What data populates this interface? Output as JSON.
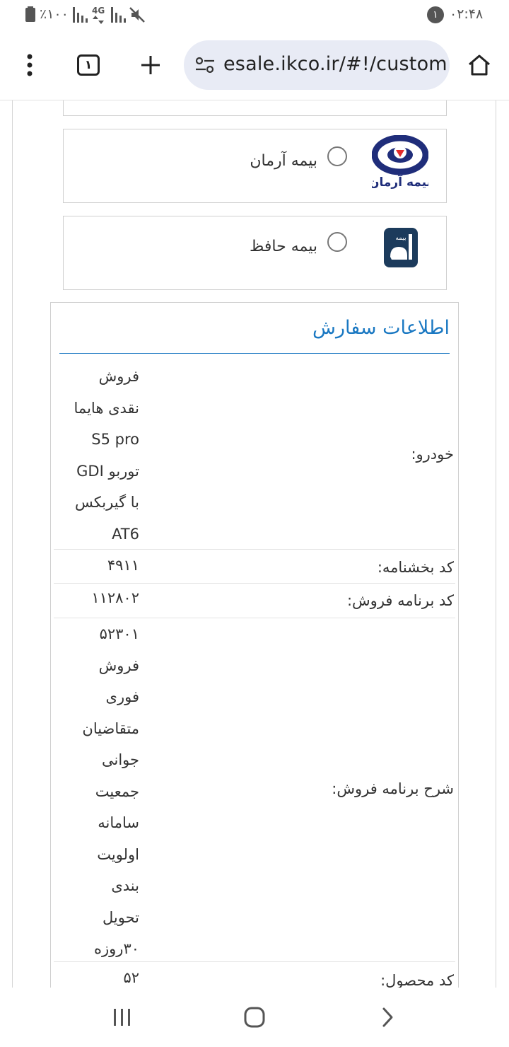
{
  "status_bar": {
    "time": "۰۲:۴۸",
    "notification_count": "۱",
    "battery_percent": "٪۱۰۰",
    "network": "4G"
  },
  "browser": {
    "url": "esale.ikco.ir/#!/custom",
    "tab_count": "۱"
  },
  "insurance_options": [
    {
      "label": "بیمه آرمان",
      "logo_text": "بیمه آرمان",
      "selected": false
    },
    {
      "label": "بیمه حافظ",
      "logo_text": "بیمه",
      "selected": false
    }
  ],
  "order": {
    "title": "اطلاعات سفارش",
    "rows": [
      {
        "label": "خودرو:",
        "value_lines": [
          "فروش",
          "نقدی هایما",
          "S5 pro",
          "توربو GDI",
          "با گیربکس",
          "AT6"
        ]
      },
      {
        "label": "کد بخشنامه:",
        "value_lines": [
          "۴۹۱۱"
        ]
      },
      {
        "label": "کد برنامه فروش:",
        "value_lines": [
          "۱۱۲۸۰۲"
        ]
      },
      {
        "label": "شرح برنامه فروش:",
        "value_lines": [
          "۵۲۳۰۱",
          "فروش",
          "فوری",
          "متقاضیان",
          "جوانی",
          "جمعیت",
          "سامانه",
          "اولویت",
          "بندی",
          "تحویل",
          "۳۰روزه"
        ]
      },
      {
        "label": "کد محصول:",
        "value_lines": [
          "۵۲"
        ]
      }
    ]
  },
  "colors": {
    "accent": "#1a78c2",
    "url_bar_bg": "#e8ebf5"
  }
}
